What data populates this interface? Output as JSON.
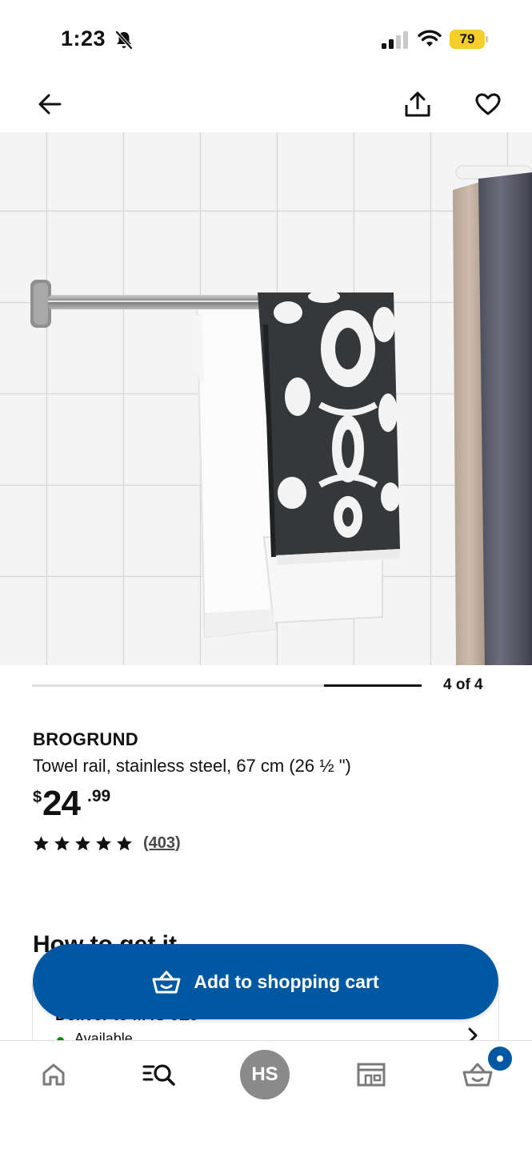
{
  "status_bar": {
    "time": "1:23",
    "battery_level": "79",
    "icons": [
      "bell-slash-icon",
      "cellular-signal-icon",
      "wifi-icon",
      "battery-icon"
    ],
    "battery_color": "#f5ce2b"
  },
  "top_nav": {
    "icons": [
      "arrow-left-icon",
      "share-icon",
      "heart-icon"
    ]
  },
  "gallery": {
    "current": 4,
    "total": 4,
    "counter_label": "4 of 4"
  },
  "product": {
    "name": "BROGRUND",
    "description": "Towel rail, stainless steel, 67 cm (26 ½ \")",
    "price_currency": "$",
    "price_integer": "24",
    "price_decimal": ".99",
    "rating_stars": 5,
    "review_count": "(403)"
  },
  "how_to_get_it": {
    "title": "How to get it",
    "delivery_label": "Deliver to M4S 0E5",
    "availability": "Available"
  },
  "cta": {
    "add_to_cart_label": "Add to shopping cart",
    "icon": "shopping-basket-icon",
    "color": "#0058a3"
  },
  "tab_bar": {
    "tabs": [
      {
        "name": "home",
        "icon": "home-icon"
      },
      {
        "name": "search",
        "icon": "search-list-icon"
      },
      {
        "name": "profile",
        "initials": "HS"
      },
      {
        "name": "stores",
        "icon": "store-icon"
      },
      {
        "name": "cart",
        "icon": "shopping-basket-icon"
      }
    ],
    "cart_badge_color": "#0058a3"
  }
}
